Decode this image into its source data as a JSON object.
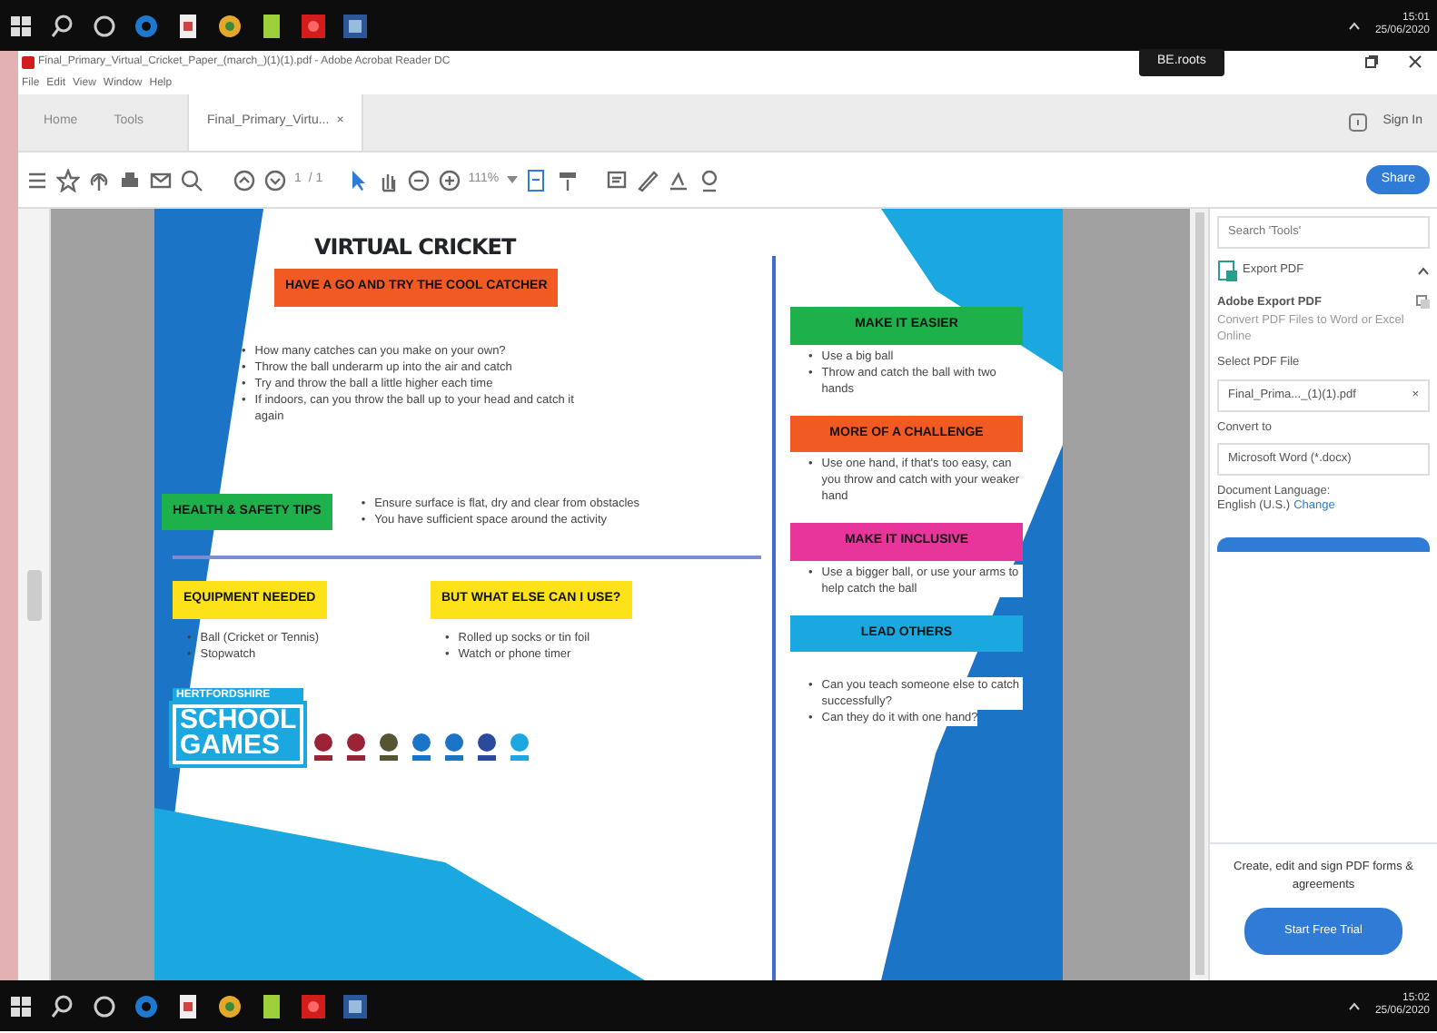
{
  "taskbar_top": {
    "time": "15:01",
    "date": "25/06/2020"
  },
  "window": {
    "title": "Final_Primary_Virtual_Cricket_Paper_(march_)(1)(1).pdf - Adobe Acrobat Reader DC"
  },
  "menu": [
    "File",
    "Edit",
    "View",
    "Window",
    "Help"
  ],
  "tooltip": "BE.roots",
  "tabs": [
    {
      "label": "Home",
      "selected": false
    },
    {
      "label": "Tools",
      "selected": false
    },
    {
      "label": "Final_Primary_Virtu...",
      "selected": true,
      "close": "×"
    }
  ],
  "sign_in": "Sign In",
  "toolbar": {
    "page": "1",
    "page_total": "/ 1",
    "zoom": "111%",
    "share": "Share"
  },
  "document": {
    "bullet": "•",
    "title": "VIRTUAL CRICKET",
    "headline": "HAVE A GO AND TRY THE COOL CATCHER",
    "steps": [
      "How many catches can you make on your own?",
      "Throw the ball underarm up into the air and catch",
      "Try and throw the ball a little higher each time",
      "If indoors, can you throw the ball up to your head and catch it again"
    ],
    "safety": {
      "heading": "HEALTH & SAFETY TIPS",
      "items": [
        "Ensure surface is flat, dry and clear from obstacles",
        "You have sufficient space around the activity"
      ]
    },
    "equipment": {
      "heading": "EQUIPMENT NEEDED",
      "items": [
        "Ball (Cricket or Tennis)",
        "Stopwatch"
      ]
    },
    "alternatives": {
      "heading": "BUT WHAT ELSE CAN I USE?",
      "items": [
        "Rolled up socks or tin foil",
        "Watch or phone timer"
      ]
    },
    "sections": [
      {
        "heading": "MAKE IT EASIER",
        "color": "#1db04b",
        "items": [
          "Use a big ball",
          "Throw and catch the ball with two hands"
        ]
      },
      {
        "heading": "MORE OF A CHALLENGE",
        "color": "#f25a24",
        "items": [
          "Use one hand, if that's too easy, can you throw and catch with your weaker hand"
        ]
      },
      {
        "heading": "MAKE IT INCLUSIVE",
        "color": "#e8359c",
        "items": [
          "Use a bigger ball, or use your arms to help catch the ball"
        ]
      },
      {
        "heading": "LEAD OTHERS",
        "color": "#1ba8e0",
        "items": [
          "Can you teach someone else to catch successfully?",
          "Can they do it with one hand?"
        ]
      }
    ],
    "logo": {
      "county": "HERTFORDSHIRE",
      "name_line1": "SCHOOL",
      "name_line2": "GAMES"
    }
  },
  "tools_panel": {
    "search_placeholder": "Search 'Tools'",
    "tool": "Export PDF",
    "heading": "Adobe Export PDF",
    "description": "Convert PDF Files to Word or Excel Online",
    "select_label": "Select PDF File",
    "file": "Final_Prima..._(1)(1).pdf",
    "remove": "×",
    "convert_label": "Convert to",
    "format": "Microsoft Word (*.docx)",
    "language_label": "Document Language:",
    "language": "English (U.S.)",
    "change": "Change",
    "promo": "Create, edit and sign PDF forms & agreements",
    "trial": "Start Free Trial"
  },
  "taskbar_bottom": {
    "time": "15:02",
    "date": "25/06/2020"
  }
}
